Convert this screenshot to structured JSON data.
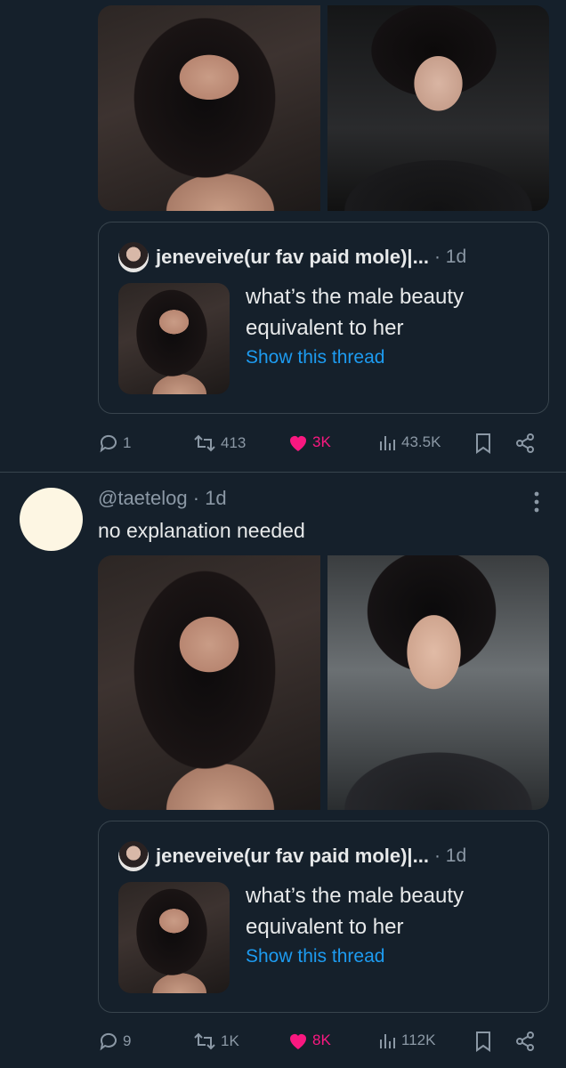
{
  "post1": {
    "quote": {
      "author": "jeneveive(ur fav paid mole)|...",
      "time": "· 1d",
      "text": "what’s the male beauty equivalent to her",
      "link": "Show this thread"
    },
    "actions": {
      "replies": "1",
      "retweets": "413",
      "likes": "3K",
      "views": "43.5K"
    }
  },
  "post2": {
    "handle": "@taetelog",
    "time": "· 1d",
    "text": "no explanation needed",
    "quote": {
      "author": "jeneveive(ur fav paid mole)|...",
      "time": "· 1d",
      "text": "what’s the male beauty equivalent to her",
      "link": "Show this thread"
    },
    "actions": {
      "replies": "9",
      "retweets": "1K",
      "likes": "8K",
      "views": "112K"
    }
  },
  "colors": {
    "background": "#15202b",
    "accent": "#1d9bf0",
    "like": "#f91880",
    "muted": "#8b98a5"
  },
  "icons": [
    "reply-icon",
    "retweet-icon",
    "heart-icon",
    "views-icon",
    "bookmark-icon",
    "share-icon",
    "more-icon"
  ]
}
